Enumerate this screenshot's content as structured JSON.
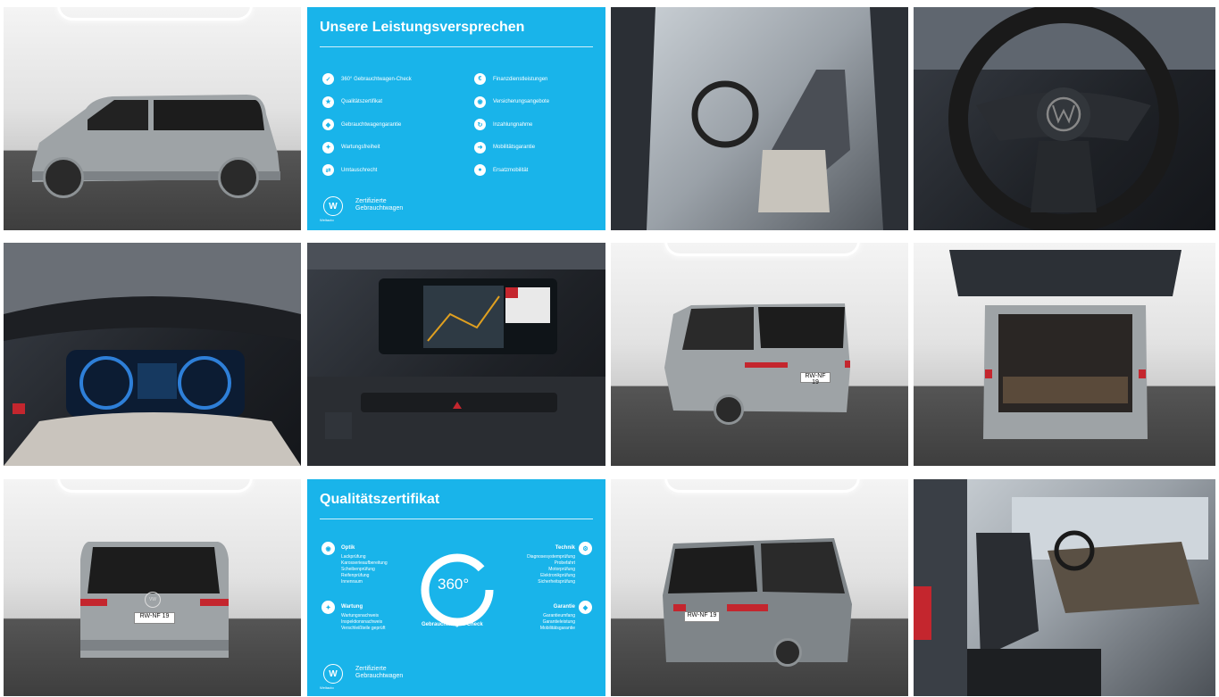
{
  "promo1": {
    "title": "Unsere Leistungsversprechen",
    "left_items": [
      "360° Gebrauchtwagen-Check",
      "Qualitätszertifikat",
      "Gebrauchtwagengarantie",
      "Wartungsfreiheit",
      "Umtauschrecht"
    ],
    "right_items": [
      "Finanzdienstleistungen",
      "Versicherungsangebote",
      "Inzahlungnahme",
      "Mobilitätsgarantie",
      "Ersatzmobilität"
    ],
    "logo_line1": "Zertifizierte",
    "logo_line2": "Gebrauchtwagen",
    "logo_sub": "Weltauto"
  },
  "promo2": {
    "title": "Qualitätszertifikat",
    "ring_value": "360°",
    "ring_caption": "Gebrauchtwagen-Check",
    "sections": {
      "optik": {
        "head": "Optik",
        "items": [
          "Lackprüfung",
          "Karosserieaufbereitung",
          "Scheibenprüfung",
          "Reifenprüfung",
          "Innenraum"
        ]
      },
      "wartung": {
        "head": "Wartung",
        "items": [
          "Wartungsnachweis",
          "Inspektionsnachweis",
          "Verschleißteile geprüft"
        ]
      },
      "technik": {
        "head": "Technik",
        "items": [
          "Diagnosesystemprüfung",
          "Probefahrt",
          "Motorprüfung",
          "Elektronikprüfung",
          "Sicherheitsprüfung"
        ]
      },
      "garantie": {
        "head": "Garantie",
        "items": [
          "Garantieumfang",
          "Garantieleistung",
          "Mobilitätsgarantie"
        ]
      }
    },
    "logo_line1": "Zertifizierte",
    "logo_line2": "Gebrauchtwagen",
    "logo_sub": "Weltauto"
  },
  "car": {
    "plate": "RW-NF 19",
    "badge": "VW",
    "body_color": "#9ea3a6",
    "accent": "#19b4ea"
  }
}
